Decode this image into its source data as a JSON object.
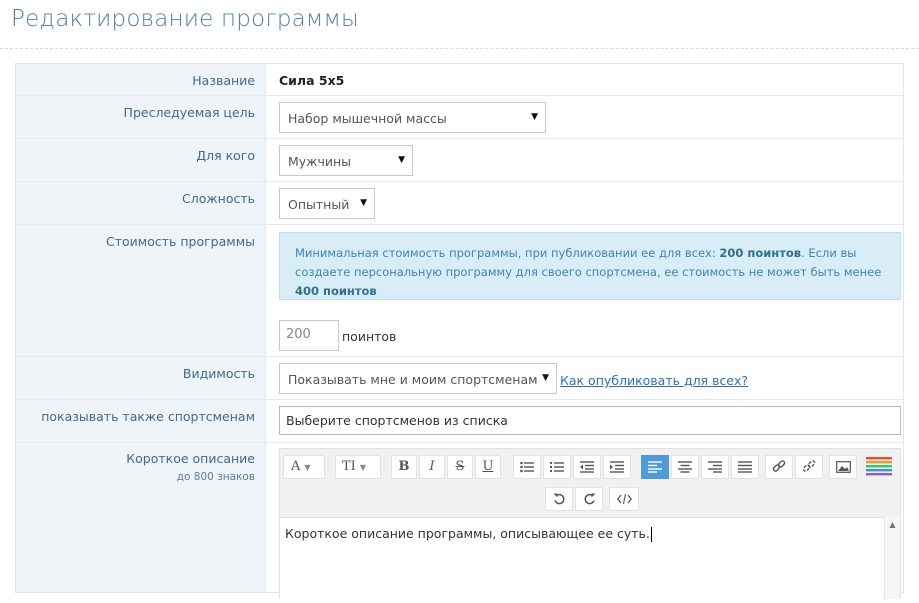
{
  "page_title": "Редактирование программы",
  "fields": {
    "name_label": "Название",
    "name_value": "Сила 5x5",
    "goal_label": "Преследуемая цель",
    "goal_value": "Набор мышечной массы",
    "for_whom_label": "Для кого",
    "for_whom_value": "Мужчины",
    "difficulty_label": "Сложность",
    "difficulty_value": "Опытный",
    "price_label": "Стоимость программы",
    "price_info": {
      "part1": "Минимальная стоимость программы, при публиковании ее для всех: ",
      "bold1": "200 поинтов",
      "part2": ". Если вы создаете персональную программу для своего спортсмена, ее стоимость не может быть менее ",
      "bold2": "400 поинтов"
    },
    "price_value": "200",
    "price_unit": "поинтов",
    "visibility_label": "Видимость",
    "visibility_value": "Показывать мне и моим спортсменам",
    "visibility_link": "Как опубликовать для всех?",
    "athletes_label": "показывать также спортсменам",
    "athletes_placeholder": "Выберите спортсменов из списка",
    "short_desc_label": "Короткое описание",
    "short_desc_hint": "до 800 знаков",
    "short_desc_value": "Короткое описание программы, описывающее ее суть."
  },
  "editor_toolbar": {
    "font_label": "A",
    "size_label": "TI",
    "bold": "B",
    "italic": "I",
    "strike": "S",
    "underline": "U",
    "active_align": "align-left"
  },
  "colors": {
    "title": "#4f7fa9",
    "label": "#3f6b8e",
    "label_bg": "#eef4f8",
    "info_bg": "#d9edf7",
    "active_btn": "#4f9bd9",
    "link": "#2a6fc9"
  }
}
